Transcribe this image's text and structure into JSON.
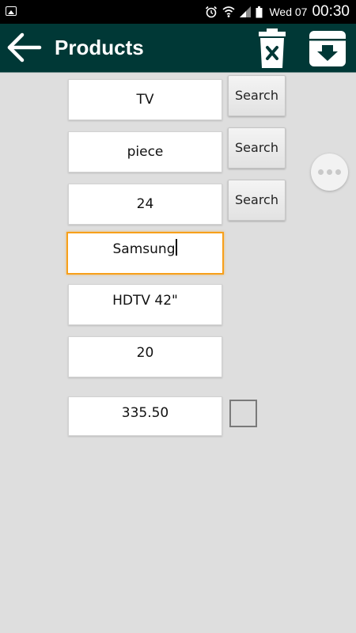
{
  "status_bar": {
    "date": "Wed 07",
    "time": "00:30",
    "icons": [
      "gallery-icon",
      "alarm-icon",
      "wifi-icon",
      "signal-icon",
      "battery-icon"
    ]
  },
  "action_bar": {
    "title": "Products",
    "background_color": "#003836",
    "icons": [
      "back-arrow-icon",
      "delete-icon",
      "archive-download-icon"
    ]
  },
  "form": {
    "category": "TV",
    "unit": "piece",
    "quantity_code": "24",
    "brand": "Samsung",
    "model": "HDTV 42\"",
    "quantity": "20",
    "price": "335.50",
    "search_label": "Search",
    "focus_color": "#f7a01b"
  },
  "checkbox": {
    "checked": false
  },
  "overflow": {
    "icon": "more-horizontal-icon"
  }
}
